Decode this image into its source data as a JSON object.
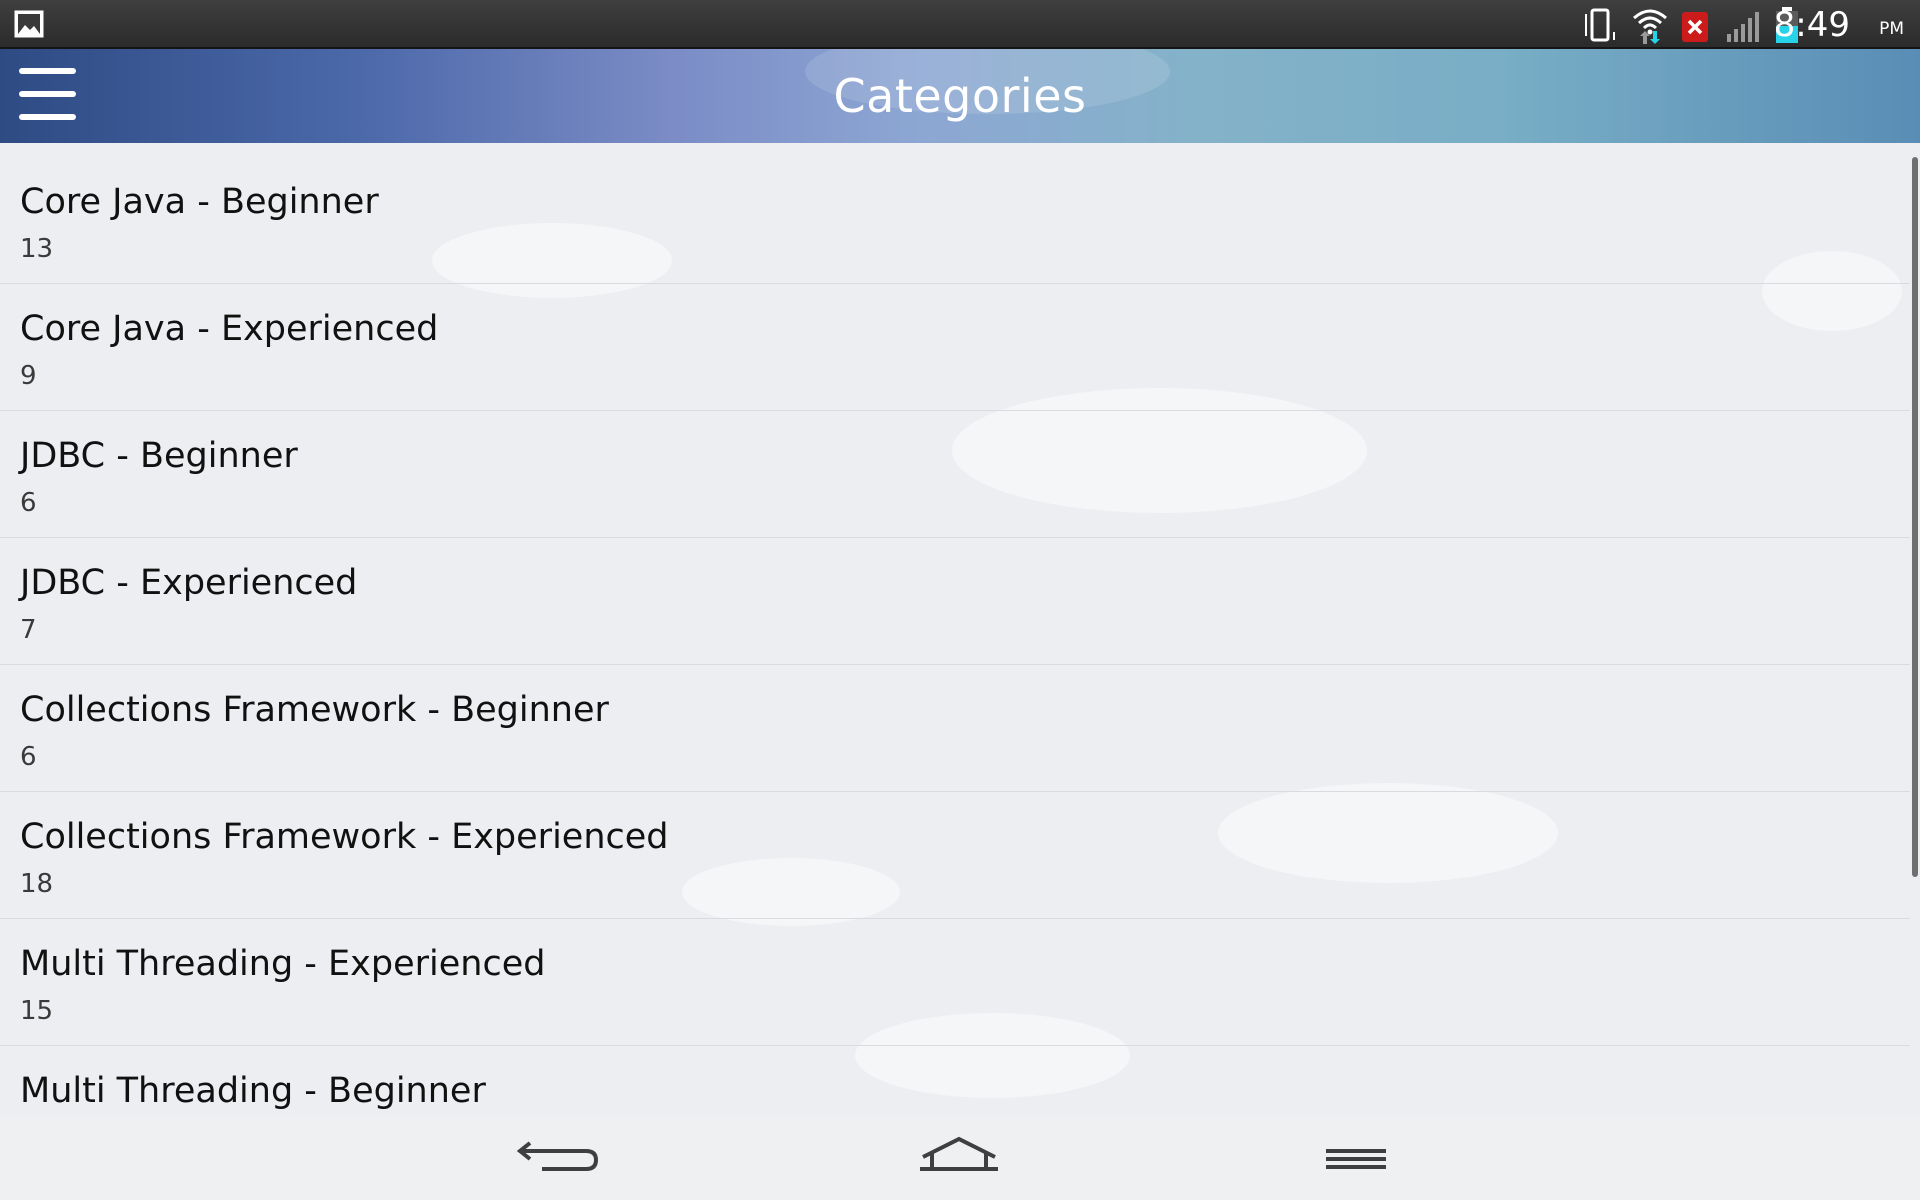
{
  "status_bar": {
    "time": "8:49",
    "ampm": "PM",
    "icons": [
      "gallery-icon",
      "vibrate-icon",
      "wifi-icon",
      "notification-error-icon",
      "signal-icon",
      "battery-icon"
    ]
  },
  "app_bar": {
    "title": "Categories",
    "menu_icon": "hamburger-menu-icon"
  },
  "categories": [
    {
      "name": "Core Java - Beginner",
      "count": "13"
    },
    {
      "name": "Core Java - Experienced",
      "count": "9"
    },
    {
      "name": "JDBC - Beginner",
      "count": "6"
    },
    {
      "name": "JDBC - Experienced",
      "count": "7"
    },
    {
      "name": "Collections Framework - Beginner",
      "count": "6"
    },
    {
      "name": "Collections Framework - Experienced",
      "count": "18"
    },
    {
      "name": "Multi Threading - Experienced",
      "count": "15"
    },
    {
      "name": "Multi Threading - Beginner",
      "count": ""
    }
  ],
  "nav_bar": {
    "icons": [
      "back-icon",
      "home-icon",
      "menu-icon"
    ]
  },
  "colors": {
    "battery_fill": "#27d3e8",
    "error_badge": "#cc1b1b",
    "app_bar_start": "#2f4b84",
    "app_bar_end": "#5a8db5"
  }
}
